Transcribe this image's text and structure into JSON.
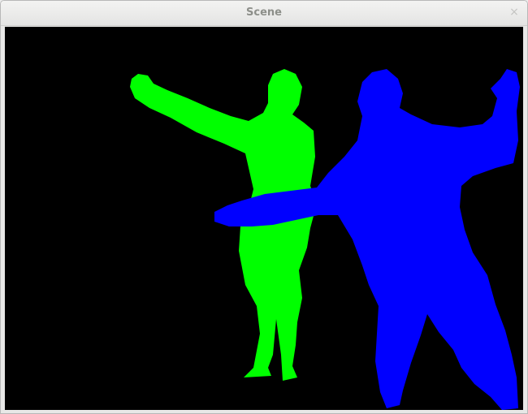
{
  "window": {
    "title": "Scene",
    "close_icon": "close-icon",
    "close_glyph": "×"
  },
  "scene": {
    "background_color": "#000000",
    "people": [
      {
        "name": "person-1-silhouette",
        "color": "#00ff00"
      },
      {
        "name": "person-2-silhouette",
        "color": "#0000ff"
      }
    ]
  }
}
